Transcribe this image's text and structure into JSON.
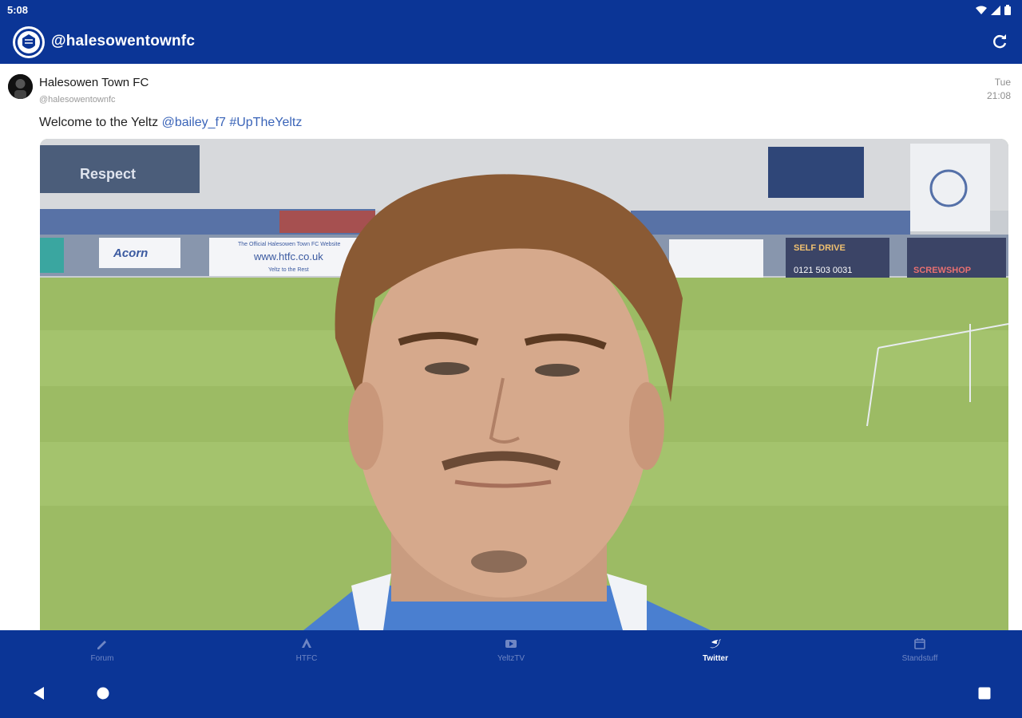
{
  "status_bar": {
    "time": "5:08",
    "icons": [
      "wifi-icon",
      "signal-icon",
      "battery-icon"
    ]
  },
  "app_bar": {
    "title": "@halesowentownfc",
    "logo": "club-crest-icon",
    "refresh_icon": "refresh-icon",
    "color": "#0b3596"
  },
  "tweet": {
    "author": "Halesowen Town FC",
    "handle": "@halesowentownfc",
    "date_day": "Tue",
    "date_time": "21:08",
    "text_plain": "Welcome to the Yeltz ",
    "mention": "@bailey_f7",
    "hashtag": "#UpTheYeltz",
    "link_color": "#3a64b8",
    "media": {
      "description_icon": "player-photo",
      "signs": {
        "respect": "Respect",
        "website": "www.htfc.co.uk",
        "official": "The Official Halesowen Town FC Website",
        "slogan": "Yeltz to the Rest",
        "acorn": "Acorn",
        "self_drive": "SELF DRIVE",
        "phone": "0121 503 0031",
        "screwfix": "SCREWSHOP"
      }
    }
  },
  "bottom_nav": {
    "items": [
      {
        "label": "Forum",
        "icon": "forum-icon",
        "active": false
      },
      {
        "label": "HTFC",
        "icon": "club-icon",
        "active": false
      },
      {
        "label": "YeltzTV",
        "icon": "video-icon",
        "active": false
      },
      {
        "label": "Twitter",
        "icon": "twitter-icon",
        "active": true
      },
      {
        "label": "Standstuff",
        "icon": "calendar-icon",
        "active": false
      }
    ]
  },
  "system_nav": {
    "back": "back-icon",
    "home": "home-icon",
    "recents": "recents-icon"
  }
}
